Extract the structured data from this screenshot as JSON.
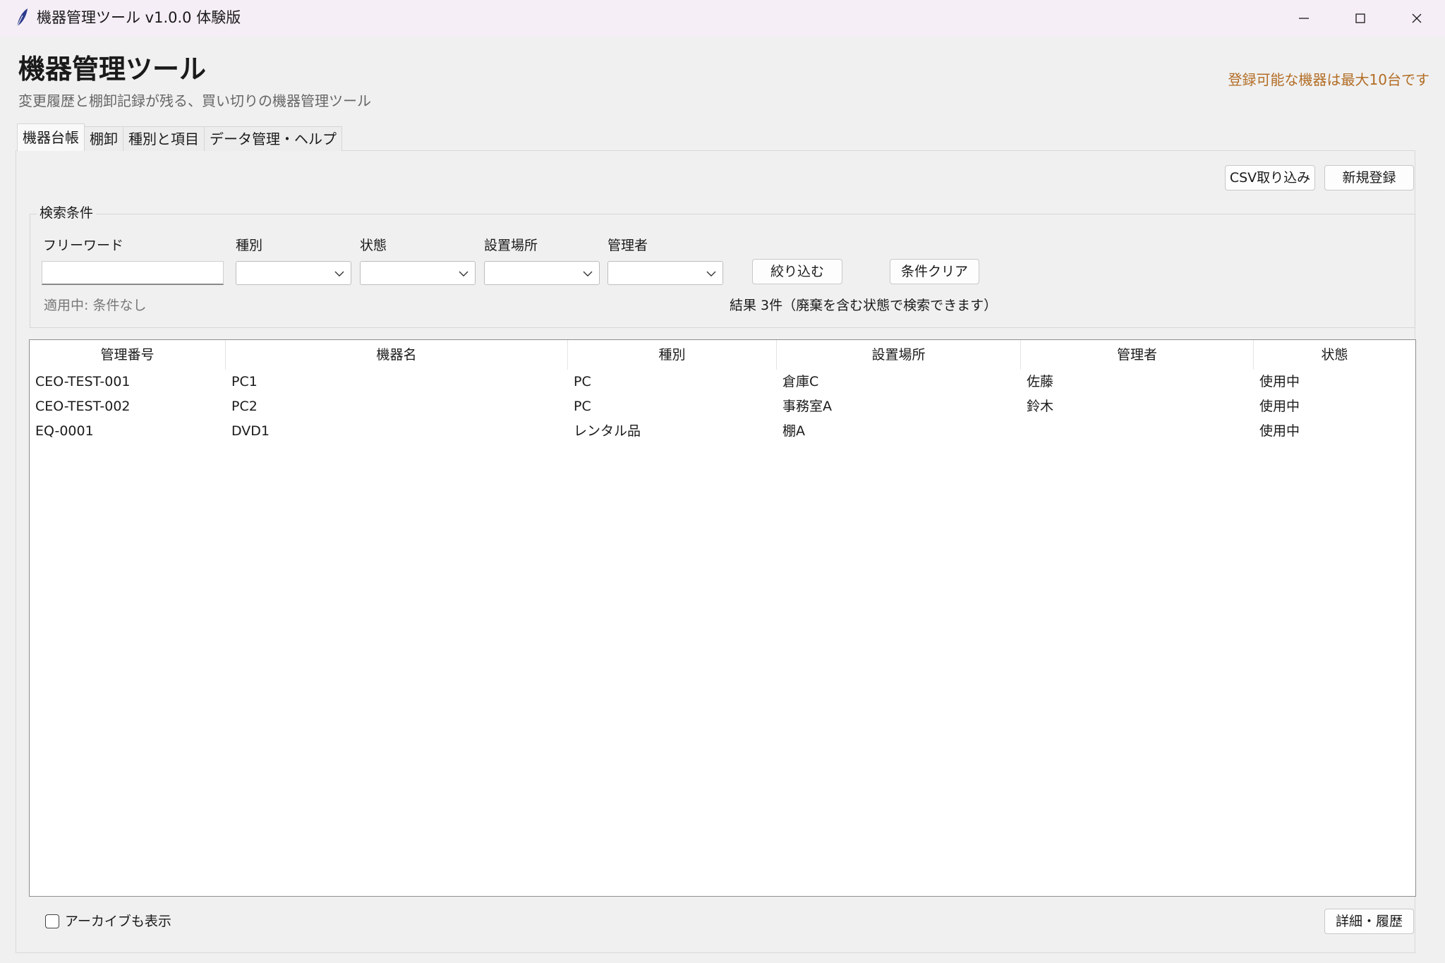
{
  "window": {
    "title": "機器管理ツール v1.0.0 体験版",
    "icons": [
      "feather-icon",
      "minimize-icon",
      "maximize-icon",
      "close-icon"
    ]
  },
  "header": {
    "title": "機器管理ツール",
    "subtitle": "変更履歴と棚卸記録が残る、買い切りの機器管理ツール",
    "limit_note": "登録可能な機器は最大10台です",
    "limit_note_color": "#b26d25"
  },
  "tabs": [
    {
      "label": "機器台帳",
      "selected": true
    },
    {
      "label": "棚卸",
      "selected": false
    },
    {
      "label": "種別と項目",
      "selected": false
    },
    {
      "label": "データ管理・ヘルプ",
      "selected": false
    }
  ],
  "toolbar": {
    "csv_import_label": "CSV取り込み",
    "new_register_label": "新規登録"
  },
  "search": {
    "legend": "検索条件",
    "freeword_label": "フリーワード",
    "freeword_value": "",
    "type_label": "種別",
    "type_value": "",
    "state_label": "状態",
    "state_value": "",
    "location_label": "設置場所",
    "location_value": "",
    "manager_label": "管理者",
    "manager_value": "",
    "filter_label": "絞り込む",
    "clear_label": "条件クリア",
    "applied_status": "適用中: 条件なし",
    "result_text": "結果 3件（廃棄を含む状態で検索できます）"
  },
  "table": {
    "columns": [
      "管理番号",
      "機器名",
      "種別",
      "設置場所",
      "管理者",
      "状態"
    ],
    "rows": [
      [
        "CEO-TEST-001",
        "PC1",
        "PC",
        "倉庫C",
        "佐藤",
        "使用中"
      ],
      [
        "CEO-TEST-002",
        "PC2",
        "PC",
        "事務室A",
        "鈴木",
        "使用中"
      ],
      [
        "EQ-0001",
        "DVD1",
        "レンタル品",
        "棚A",
        "",
        "使用中"
      ]
    ]
  },
  "footer": {
    "show_archive_label": "アーカイブも表示",
    "show_archive_checked": false,
    "detail_history_label": "詳細・履歴"
  }
}
